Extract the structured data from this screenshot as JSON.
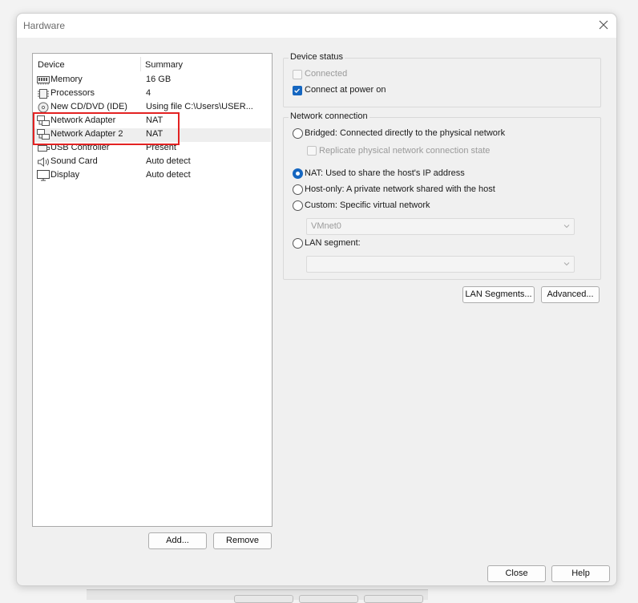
{
  "window": {
    "title": "Hardware"
  },
  "device_list": {
    "col_device": "Device",
    "col_summary": "Summary",
    "devices": [
      {
        "icon": "memory-icon",
        "name": "Memory",
        "summary": "16 GB"
      },
      {
        "icon": "processor-icon",
        "name": "Processors",
        "summary": "4"
      },
      {
        "icon": "cd-dvd-icon",
        "name": "New CD/DVD (IDE)",
        "summary": "Using file C:\\Users\\USER..."
      },
      {
        "icon": "network-adapter-icon",
        "name": "Network Adapter",
        "summary": "NAT"
      },
      {
        "icon": "network-adapter-icon",
        "name": "Network Adapter 2",
        "summary": "NAT"
      },
      {
        "icon": "usb-icon",
        "name": "USB Controller",
        "summary": "Present"
      },
      {
        "icon": "speaker-icon",
        "name": "Sound Card",
        "summary": "Auto detect"
      },
      {
        "icon": "monitor-icon",
        "name": "Display",
        "summary": "Auto detect"
      }
    ],
    "selected": "Network Adapter 2"
  },
  "list_buttons": {
    "add": "Add...",
    "remove": "Remove"
  },
  "device_status": {
    "title": "Device status",
    "connected": {
      "label": "Connected",
      "checked": false,
      "enabled": false
    },
    "connect_at_power_on": {
      "label": "Connect at power on",
      "checked": true,
      "enabled": true
    }
  },
  "network_connection": {
    "title": "Network connection",
    "bridged": "Bridged: Connected directly to the physical network",
    "replicate": "Replicate physical network connection state",
    "nat": "NAT: Used to share the host's IP address",
    "host_only": "Host-only: A private network shared with the host",
    "custom": "Custom: Specific virtual network",
    "custom_select": "VMnet0",
    "lan_segment": "LAN segment:",
    "lan_select": "",
    "selected": "nat"
  },
  "panel_buttons": {
    "lan_segments": "LAN Segments...",
    "advanced": "Advanced..."
  },
  "footer": {
    "close": "Close",
    "help": "Help"
  },
  "colors": {
    "accent": "#1566c0",
    "highlight_box": "#e32222"
  }
}
